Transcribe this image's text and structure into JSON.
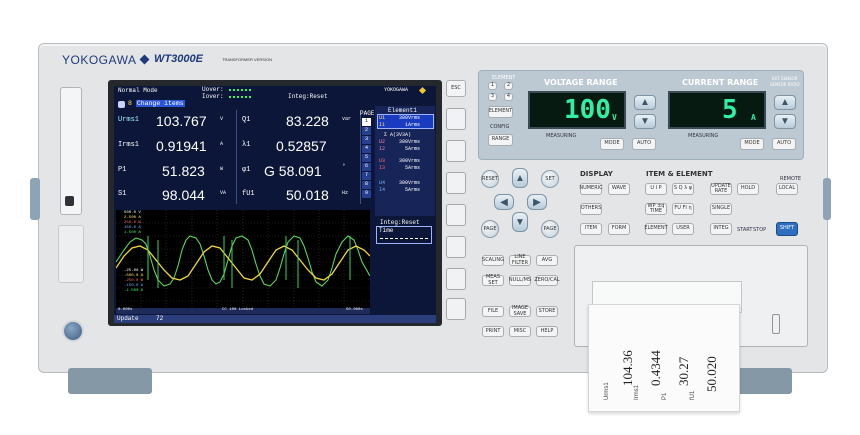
{
  "device": {
    "brand": "YOKOGAWA",
    "model": "WT3000E",
    "subtitle": "TRANSFORMER VERSION"
  },
  "screen": {
    "mode": "Normal Mode",
    "uover": "Uover:",
    "iover": "Iover:",
    "integ_status": "Integ:Reset",
    "brand": "YOKOGAWA",
    "change_items": "Change items",
    "page_label": "PAGE",
    "measurements_left": [
      {
        "label": "Urms1",
        "value": "103.767",
        "unit": "V"
      },
      {
        "label": "Irms1",
        "value": "0.91941",
        "unit": "A"
      },
      {
        "label": "P1",
        "value": "51.823",
        "unit": "W"
      },
      {
        "label": "S1",
        "value": "98.044",
        "unit": "VA"
      }
    ],
    "measurements_right": [
      {
        "label": "Q1",
        "value": "83.228",
        "unit": "var"
      },
      {
        "label": "λ1",
        "value": "0.52857",
        "unit": ""
      },
      {
        "label": "φ1",
        "value": "G 58.091",
        "unit": "°"
      },
      {
        "label": "fU1",
        "value": "50.018",
        "unit": "Hz"
      }
    ],
    "element_panel": {
      "title": "Element1",
      "u1": "U1",
      "u1_range": "300Vrms",
      "i1": "I1",
      "i1_range": "1Arms",
      "sigma": "Σ A(3V3A)",
      "u2": "U2",
      "u2_range": "300Vrms",
      "i2": "I2",
      "i2_range": "5Arms",
      "u3": "U3",
      "u3_range": "300Vrms",
      "i3": "I3",
      "i3_range": "5Arms",
      "u4": "U4",
      "u4_range": "300Vrms",
      "i4": "I4",
      "i4_range": "5Arms",
      "integ_title": "Integ:Reset",
      "integ_time_label": "Time"
    },
    "pages": [
      "1",
      "2",
      "3",
      "4",
      "5",
      "6",
      "7",
      "8",
      "9"
    ],
    "wave_labels_top": [
      "500.0 V",
      "2.500 A",
      "250.0 W",
      "150.0 A",
      "1.500 A"
    ],
    "wave_labels_bottom": [
      "-25.00 W",
      "-500.0 A",
      "-250.0 W",
      "-150.0 A",
      "-1.500 A"
    ],
    "wave_time_left": "0.000s",
    "wave_time_mid": "CC 100 Locked",
    "wave_time_right": "50.000s",
    "update_label": "Update",
    "update_count": "72"
  },
  "voltage": {
    "title": "VOLTAGE RANGE",
    "value": "100",
    "unit": "V",
    "mode": "MODE",
    "auto": "AUTO",
    "measuring": "MEASURING"
  },
  "current": {
    "title": "CURRENT RANGE",
    "value": "5",
    "unit": "A",
    "mode": "MODE",
    "auto": "AUTO",
    "measuring": "MEASURING"
  },
  "element_panel_small": {
    "title": "ELEMENT",
    "digits": [
      "1",
      "2",
      "3",
      "4"
    ],
    "element_btn": "ELEMENT",
    "config": "CONFIG",
    "range": "RANGE"
  },
  "ext_sensor": {
    "title": "EXT SENSOR",
    "sub": "SENSOR RATIO"
  },
  "nav": {
    "reset": "RESET",
    "set": "SET",
    "page_up": "PAGE",
    "page_down": "PAGE"
  },
  "display": {
    "title": "DISPLAY",
    "numeric": "NUMERIC",
    "wave": "WAVE",
    "others": "OTHERS",
    "item": "ITEM",
    "form": "FORM"
  },
  "item_element": {
    "title": "ITEM & ELEMENT",
    "uip": "U I P",
    "sqp": "S Q λ φ",
    "wp": "WP ±q TIME",
    "fu": "FU FI η",
    "element": "ELEMENT",
    "user": "USER"
  },
  "integ": {
    "update_rate": "UPDATE RATE",
    "hold": "HOLD",
    "single": "SINGLE",
    "integ": "INTEG",
    "start": "START",
    "stop": "STOP"
  },
  "remote": {
    "label": "REMOTE",
    "local": "LOCAL",
    "shift": "SHIFT"
  },
  "lower_left": [
    "SCALING",
    "LINE FILTER",
    "AVG",
    "MEAS SET",
    "NULL/MS",
    "ZERO/CAL"
  ],
  "lower_left2": [
    "FILE",
    "IMAGE SAVE",
    "STORE",
    "PRINT",
    "MISC",
    "HELP"
  ],
  "esc": "ESC",
  "printout": {
    "values": [
      "104.36",
      "0.4344",
      "30.27",
      "50.020"
    ],
    "labels": [
      "Urms1",
      "Irms1",
      "P1",
      "fU1"
    ]
  }
}
